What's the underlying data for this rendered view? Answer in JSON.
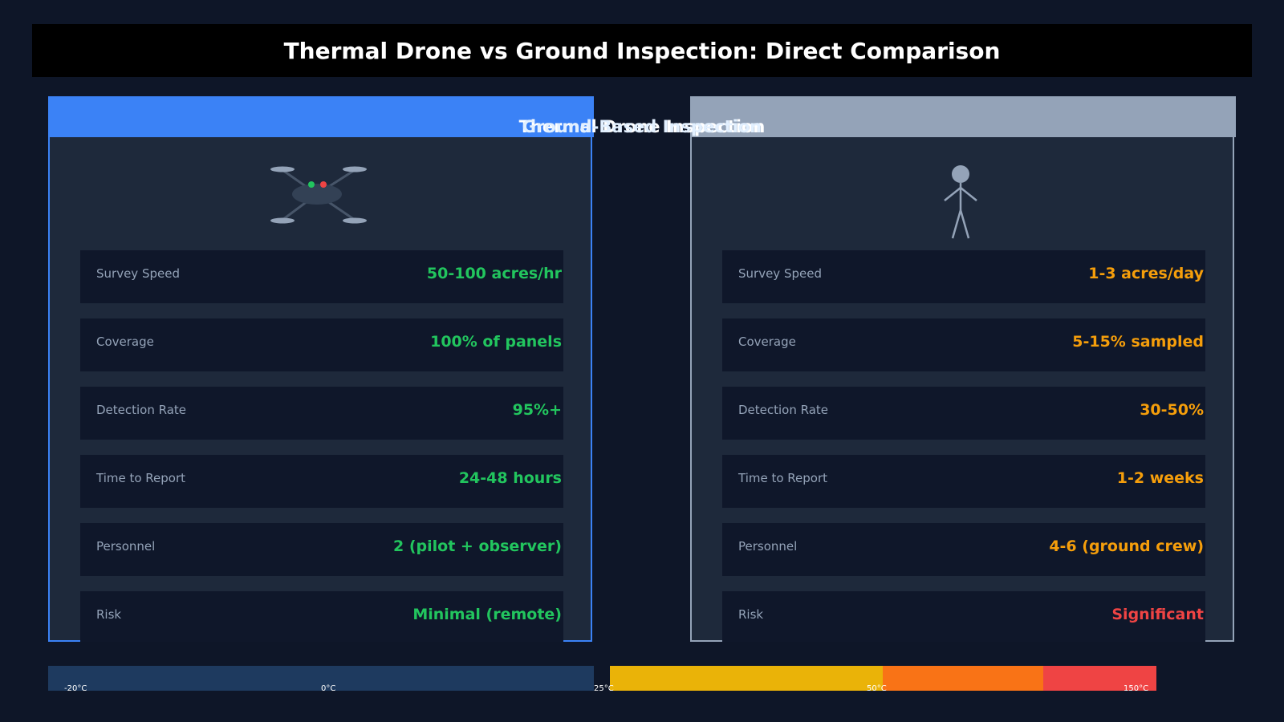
{
  "title": "Thermal Drone vs Ground Inspection: Direct Comparison",
  "panels": {
    "drone": {
      "title": "Thermal Drone Inspection",
      "metrics": [
        {
          "label": "Survey Speed",
          "value": "50-100 acres/hr"
        },
        {
          "label": "Coverage",
          "value": "100% of panels"
        },
        {
          "label": "Detection Rate",
          "value": "95%+"
        },
        {
          "label": "Time to Report",
          "value": "24-48 hours"
        },
        {
          "label": "Personnel",
          "value": "2 (pilot + observer)"
        },
        {
          "label": "Risk",
          "value": "Minimal (remote)"
        }
      ],
      "icon": "drone-icon",
      "color": "#3b82f6",
      "value_color": "#22c55e"
    },
    "ground": {
      "title": "Ground-Based Inspection",
      "metrics": [
        {
          "label": "Survey Speed",
          "value": "1-3 acres/day"
        },
        {
          "label": "Coverage",
          "value": "5-15% sampled"
        },
        {
          "label": "Detection Rate",
          "value": "30-50%"
        },
        {
          "label": "Time to Report",
          "value": "1-2 weeks"
        },
        {
          "label": "Personnel",
          "value": "4-6 (ground crew)"
        },
        {
          "label": "Risk",
          "value": "Significant"
        }
      ],
      "icon": "person-icon",
      "color": "#94a3b8",
      "value_color": "#f59e0b",
      "risk_color": "#ef4444"
    }
  },
  "temperature_scale": {
    "ticks": [
      "-20°C",
      "0°C",
      "25°C",
      "50°C",
      "150°C"
    ],
    "colors": [
      "#1e3a5f",
      "#eab308",
      "#f97316",
      "#ef4444"
    ]
  }
}
